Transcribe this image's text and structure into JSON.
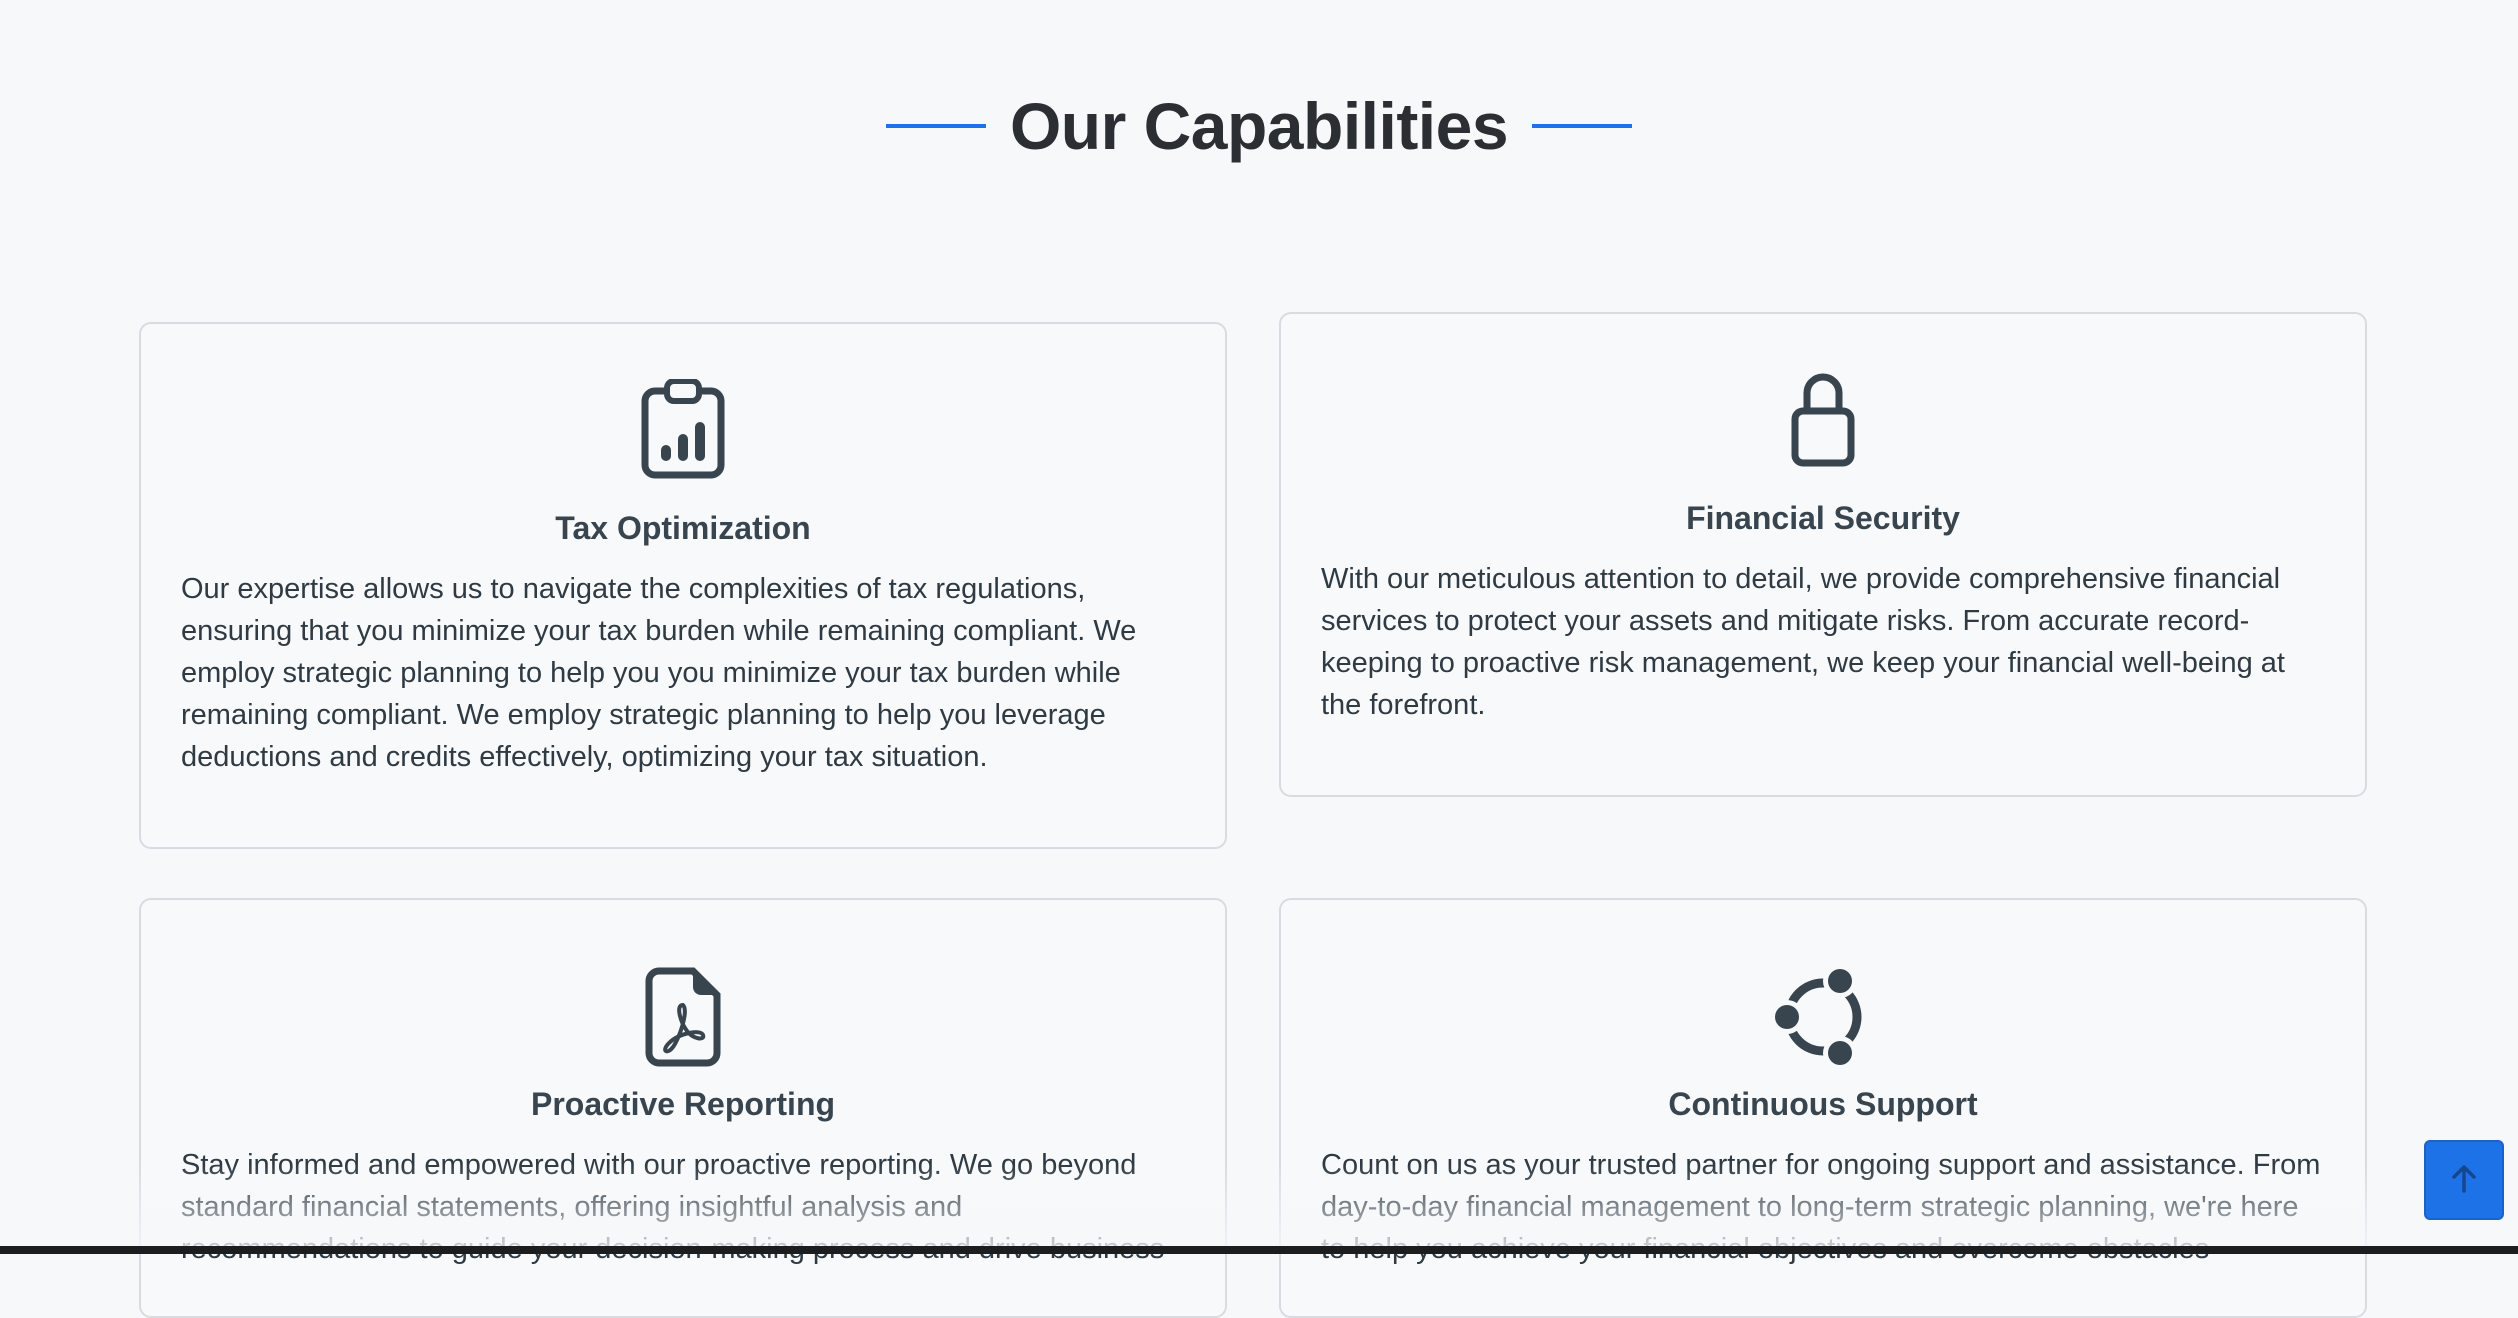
{
  "section": {
    "title": "Our Capabilities"
  },
  "cards": [
    {
      "title": "Tax Optimization",
      "icon": "clipboard-chart-icon",
      "text": "Our expertise allows us to navigate the complexities of tax regulations, ensuring that you minimize your tax burden while remaining compliant. We employ strategic planning to help you you minimize your tax burden while remaining compliant. We employ strategic planning to help you leverage deductions and credits effectively, optimizing your tax situation."
    },
    {
      "title": "Financial Security",
      "icon": "lock-icon",
      "text": "With our meticulous attention to detail, we provide comprehensive financial services to protect your assets and mitigate risks. From accurate record-keeping to proactive risk management, we keep your financial well-being at the forefront."
    },
    {
      "title": "Proactive Reporting",
      "icon": "pdf-file-icon",
      "text": "Stay informed and empowered with our proactive reporting. We go beyond standard financial statements, offering insightful analysis and recommendations to guide your decision-making process and drive business"
    },
    {
      "title": "Continuous Support",
      "icon": "ubuntu-circle-icon",
      "text": "Count on us as your trusted partner for ongoing support and assistance. From day-to-day financial management to long-term strategic planning, we're here to help you achieve your financial objectives and overcome obstacles"
    }
  ],
  "back_to_top": {
    "icon": "arrow-up-icon"
  },
  "colors": {
    "accent": "#1d72e8",
    "background": "#f6f8fa",
    "icon": "#38454f"
  }
}
